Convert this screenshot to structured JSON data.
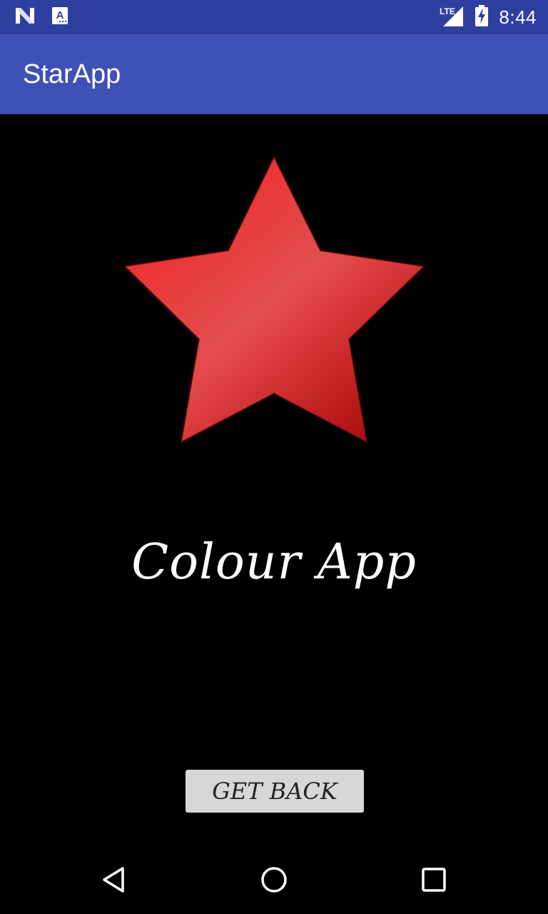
{
  "status_bar": {
    "time": "8:44",
    "network": "LTE",
    "icons": [
      "n-notification-icon",
      "a-notification-icon",
      "lte-signal-icon",
      "battery-charging-icon"
    ],
    "background": "#2f3f9f"
  },
  "app_bar": {
    "title": "StarApp",
    "background": "#3f51b5"
  },
  "main": {
    "image_icon": "red-star-icon",
    "star_color": "#e53935",
    "headline": "Colour App",
    "button_label": "GET BACK",
    "button_background": "#d6d7d7"
  },
  "nav_bar": {
    "icons": [
      "back-icon",
      "home-icon",
      "recents-icon"
    ]
  }
}
